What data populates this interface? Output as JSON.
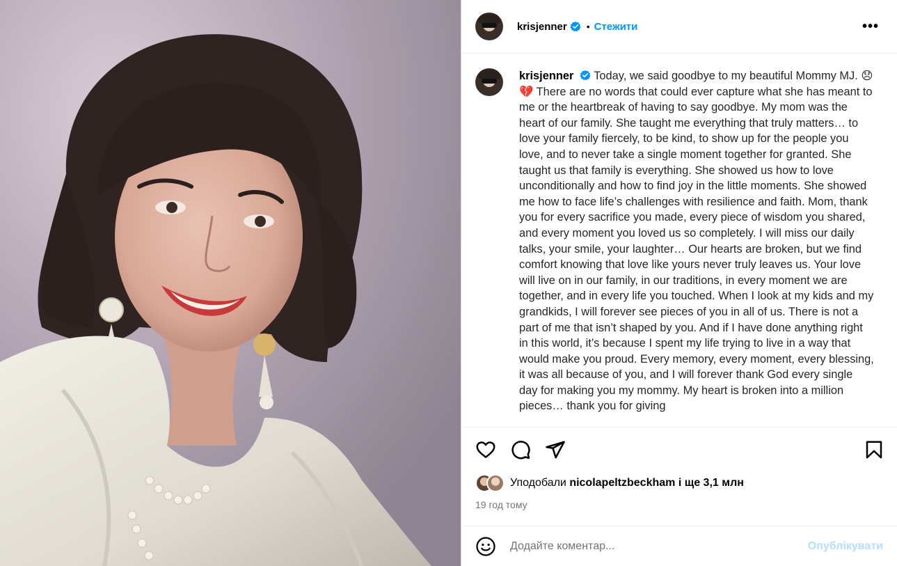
{
  "header": {
    "username": "krisjenner",
    "separator": "•",
    "follow_label": "Стежити",
    "more_label": "•••"
  },
  "caption": {
    "username": "krisjenner",
    "text": "Today, we said goodbye to my beautiful Mommy MJ. 😞💔 There are no words that could ever capture what she has meant to me or the heartbreak of having to say goodbye. My mom was the heart of our family. She taught me everything that truly matters… to love your family fiercely, to be kind, to show up for the people you love, and to never take a single moment together for granted. She taught us that family is everything. She showed us how to love unconditionally and how to find joy in the little moments. She showed me how to face life’s challenges with resilience and faith. Mom, thank you for every sacrifice you made, every piece of wisdom you shared, and every moment you loved us so completely. I will miss our daily talks, your smile, your laughter… Our hearts are broken, but we find comfort knowing that love like yours never truly leaves us. Your love will live on in our family, in our traditions, in every moment we are together, and in every life you touched. When I look at my kids and my grandkids, I will forever see pieces of you in all of us. There is not a part of me that isn’t shaped by you. And if I have done anything right in this world, it’s because I spent my life trying to live in a way that would make you proud. Every memory, every moment, every blessing, it was all because of you, and I will forever thank God every single day for making you my mommy. My heart is broken into a million pieces… thank you for giving"
  },
  "likes": {
    "prefix": "Уподобали",
    "user": "nicolapeltzbeckham",
    "suffix": "і ще 3,1 млн"
  },
  "time_label": "19 год тому",
  "comment": {
    "placeholder": "Додайте коментар...",
    "publish_label": "Опублікувати"
  },
  "icons": {
    "verified": "verified-badge-icon",
    "like": "heart-icon",
    "comment": "comment-icon",
    "share": "share-icon",
    "save": "bookmark-icon",
    "emoji": "emoji-icon"
  },
  "colors": {
    "accent": "#0095f6",
    "publish_disabled": "#b2dffc",
    "secondary_text": "#737373",
    "verified": "#0095f6"
  }
}
